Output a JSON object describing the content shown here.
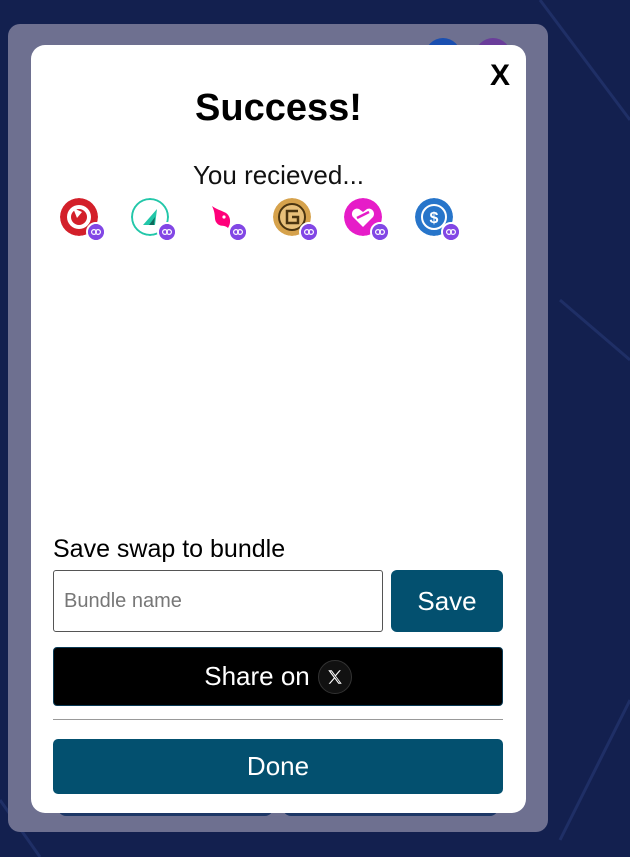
{
  "modal": {
    "close_label": "X",
    "title": "Success!",
    "subtitle": "You recieved...",
    "tokens": [
      {
        "icon": "red-token-icon",
        "color": "#d3202a"
      },
      {
        "icon": "green-arrow-token-icon",
        "color": "#22c7a9"
      },
      {
        "icon": "unicorn-token-icon",
        "color": "#ff007a"
      },
      {
        "icon": "gold-coin-token-icon",
        "color": "#d6a24c"
      },
      {
        "icon": "pink-heart-token-icon",
        "color": "#e61cc8"
      },
      {
        "icon": "usdc-token-icon",
        "color": "#2775ca"
      }
    ],
    "chain_badge_color": "#8247e5",
    "save_section_label": "Save swap to bundle",
    "bundle_input_placeholder": "Bundle name",
    "bundle_input_value": "",
    "save_button_label": "Save",
    "share_button_label": "Share on",
    "done_button_label": "Done"
  },
  "colors": {
    "primary_button": "#03506f",
    "background": "#13204f",
    "overlay": "#6e7090"
  }
}
